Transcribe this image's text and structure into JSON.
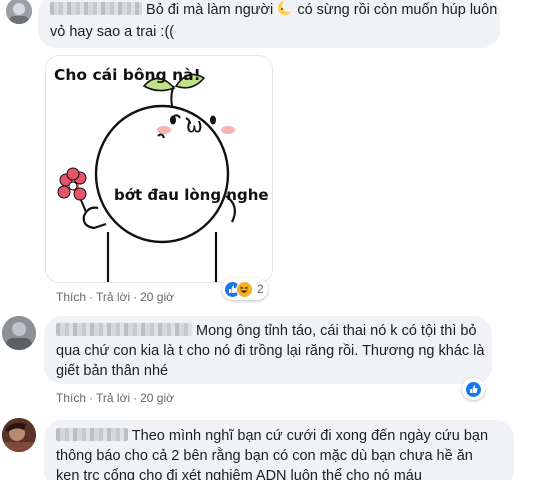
{
  "comments": [
    {
      "name_blurred": true,
      "text_line1_a": "Bỏ đi mà làm người",
      "text_line1_emoji": "crescent-moon-emoji",
      "text_line1_b": "có sừng rồi còn muốn húp luôn",
      "text_line2": "vỏ hay sao a trai :((",
      "sticker": {
        "caption_top": "Cho cái bông nà!",
        "caption_middle": "bớt đau lòng nghe"
      },
      "actions": {
        "like": "Thích",
        "reply": "Trả lời",
        "time": "20 giờ"
      },
      "reactions": {
        "icons": [
          "like-icon",
          "haha-icon"
        ],
        "count": "2"
      }
    },
    {
      "name_blurred": true,
      "text_line1": "Mong ông tỉnh táo, cái thai nó k có tội thì bỏ",
      "text_line2": "qua chứ con kia là t cho nó đi trồng lại răng rồi. Thương ng khác là",
      "text_line3": "giết bản thân nhé",
      "actions": {
        "like": "Thích",
        "reply": "Trả lời",
        "time": "20 giờ"
      },
      "reactions": {
        "icons": [
          "like-icon"
        ],
        "count": ""
      }
    },
    {
      "name_blurred": true,
      "text_line1": "Theo mình nghĩ bạn cứ cưới đi xong đến ngày cứu bạn",
      "text_line2": "thông báo cho cả 2 bên rằng bạn có con mặc dù bạn chưa hề ăn",
      "text_line3": "ken trc cổng cho đi xét nghiệm ADN luôn thể cho nó máu"
    }
  ],
  "colors": {
    "bubble": "#f0f2f5",
    "meta": "#65676b",
    "like": "#1877f2",
    "haha": "#f7b125",
    "flower": "#e8556a"
  }
}
